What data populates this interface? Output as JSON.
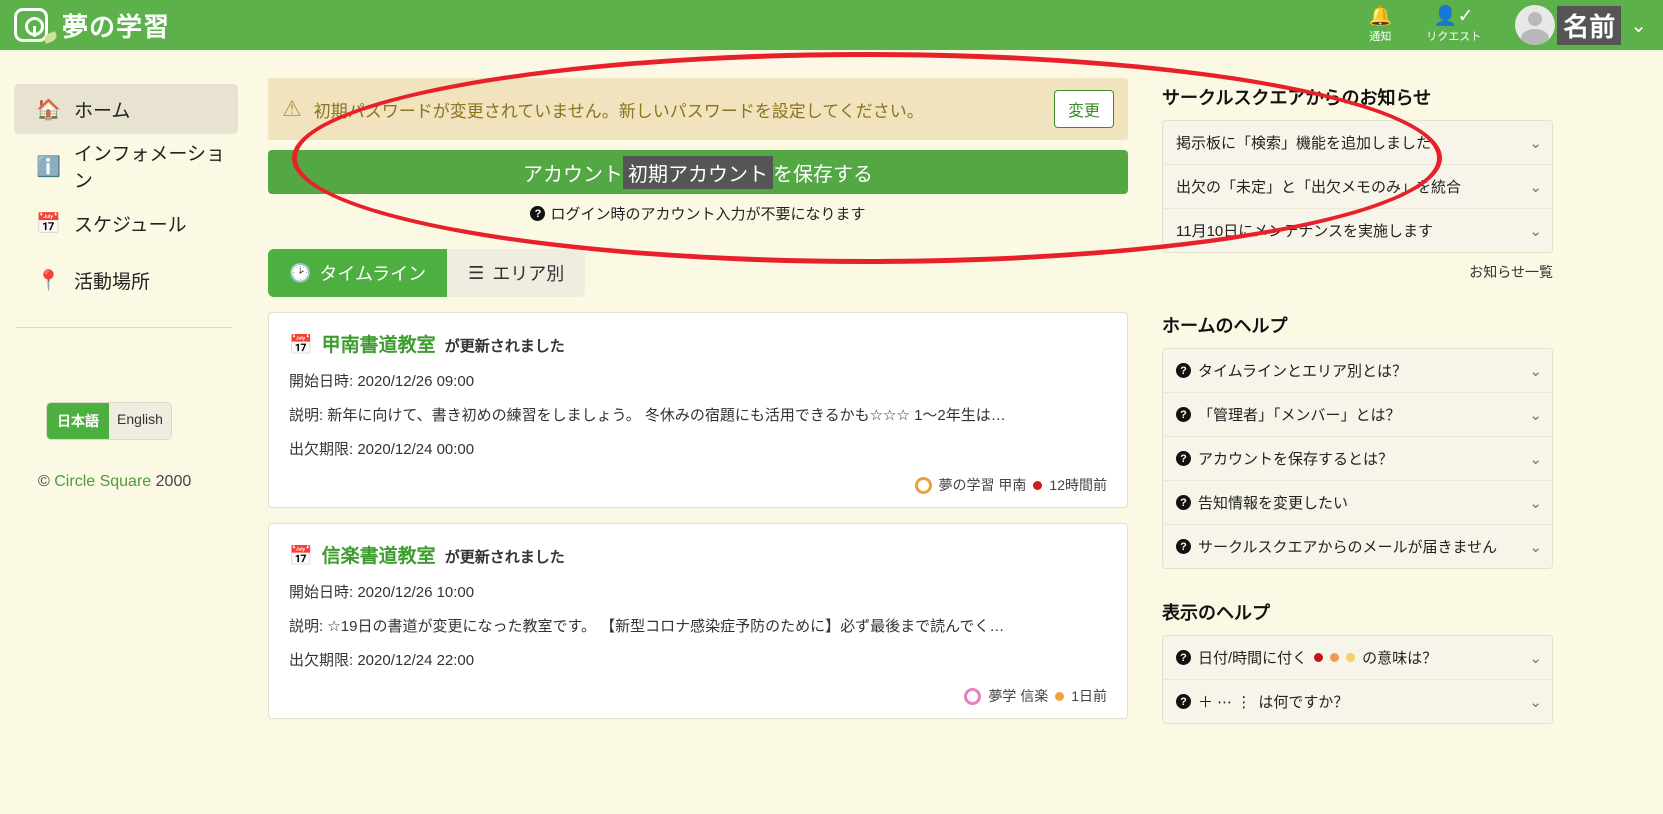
{
  "header": {
    "brand_title": "夢の学習",
    "logo_icon": "circle-square-logo",
    "notifications": {
      "icon": "bell-icon",
      "label": "通知"
    },
    "requests": {
      "icon": "user-check-icon",
      "label": "リクエスト"
    },
    "user": {
      "avatar_icon": "avatar",
      "name": "名前",
      "chevron": "⌄"
    },
    "brand_color": "#5cb14b"
  },
  "sidebar": {
    "items": [
      {
        "icon": "home-icon",
        "glyph": "🏠",
        "label": "ホーム",
        "active": true
      },
      {
        "icon": "info-icon",
        "glyph": "ℹ",
        "label": "インフォメーション",
        "active": false
      },
      {
        "icon": "calendar-icon",
        "glyph": "📅",
        "label": "スケジュール",
        "active": false
      },
      {
        "icon": "map-pin-icon",
        "glyph": "📍",
        "label": "活動場所",
        "active": false
      }
    ],
    "language": {
      "options": [
        "日本語",
        "English"
      ],
      "selected": "日本語"
    },
    "copyright": {
      "mark": "©",
      "name": "Circle Square",
      "year": "2000"
    }
  },
  "main": {
    "alert": {
      "icon": "warning-triangle-icon",
      "text": "初期パスワードが変更されていません。新しいパスワードを設定してください。",
      "button_label": "変更",
      "bg_color": "#f0e3bd",
      "text_color": "#8a7420"
    },
    "save_account": {
      "prefix": "アカウント",
      "highlight": "初期アカウント",
      "suffix": "を保存する",
      "hint_icon": "question-circle-icon",
      "hint": "ログイン時のアカウント入力が不要になります",
      "button_color": "#54a844"
    },
    "tabs": [
      {
        "icon": "clock-icon",
        "glyph": "🕑",
        "label": "タイムライン",
        "active": true
      },
      {
        "icon": "list-icon",
        "glyph": "☰",
        "label": "エリア別",
        "active": false
      }
    ],
    "cards": [
      {
        "icon": "calendar-icon",
        "title": "甲南書道教室",
        "subtitle": "が更新されました",
        "start_label": "開始日時:",
        "start_value": "2020/12/26 09:00",
        "desc_label": "説明:",
        "desc_value": "新年に向けて、書き初めの練習をしましょう。 冬休みの宿題にも活用できるかも☆☆☆ 1〜2年生は…",
        "deadline_label": "出欠期限:",
        "deadline_value": "2020/12/24 00:00",
        "group_icon": "group-circle-icon",
        "group_color": "#e8a33d",
        "group_name": "夢の学習 甲南",
        "status_color": "#d21a1a",
        "time_ago": "12時間前"
      },
      {
        "icon": "calendar-icon",
        "title": "信楽書道教室",
        "subtitle": "が更新されました",
        "start_label": "開始日時:",
        "start_value": "2020/12/26 10:00",
        "desc_label": "説明:",
        "desc_value": "☆19日の書道が変更になった教室です。 【新型コロナ感染症予防のために】必ず最後まで読んでく…",
        "deadline_label": "出欠期限:",
        "deadline_value": "2020/12/24 22:00",
        "group_icon": "group-circle-icon",
        "group_color": "#e87fc0",
        "group_name": "夢学 信楽",
        "status_color": "#f0a33c",
        "time_ago": "1日前"
      }
    ]
  },
  "rail": {
    "news": {
      "heading": "サークルスクエアからのお知らせ",
      "items": [
        {
          "label": "掲示板に「検索」機能を追加しました",
          "chevron": "⌄"
        },
        {
          "label": "出欠の「未定」と「出欠メモのみ」を統合",
          "chevron": "⌄"
        },
        {
          "label": "11月10日にメンテナンスを実施します",
          "chevron": "⌄"
        }
      ],
      "more_label": "お知らせ一覧"
    },
    "home_help": {
      "heading": "ホームのヘルプ",
      "items": [
        {
          "icon": "question-circle-icon",
          "label": "タイムラインとエリア別とは？",
          "chevron": "⌄"
        },
        {
          "icon": "question-circle-icon",
          "label": "「管理者」「メンバー」とは？",
          "chevron": "⌄"
        },
        {
          "icon": "question-circle-icon",
          "label": "アカウントを保存するとは？",
          "chevron": "⌄"
        },
        {
          "icon": "question-circle-icon",
          "label": "告知情報を変更したい",
          "chevron": "⌄"
        },
        {
          "icon": "question-circle-icon",
          "label": "サークルスクエアからのメールが届きません",
          "chevron": "⌄"
        }
      ]
    },
    "display_help": {
      "heading": "表示のヘルプ",
      "items": [
        {
          "icon": "question-circle-icon",
          "label_pre": "日付/時間に付く",
          "dots": [
            "#c0161a",
            "#ef9b56",
            "#f7cf62"
          ],
          "label_post": "の意味は？",
          "chevron": "⌄"
        },
        {
          "icon": "question-circle-icon",
          "label_pre": "＋ ⋯ ⋮",
          "label_post": "は何ですか？",
          "chevron": "⌄"
        }
      ]
    }
  },
  "annotation": {
    "shape": "red-ellipse-highlight",
    "color": "#e8202a"
  }
}
